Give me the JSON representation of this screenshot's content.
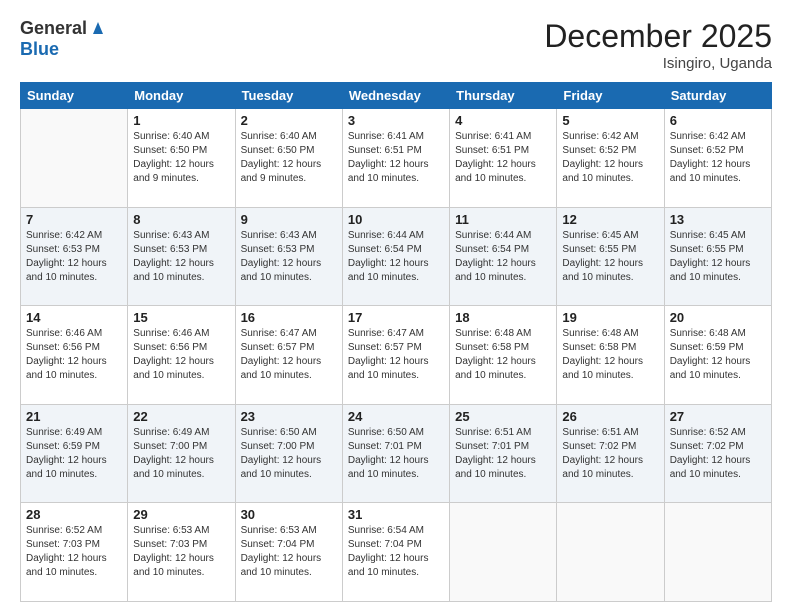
{
  "logo": {
    "general": "General",
    "blue": "Blue"
  },
  "header": {
    "title": "December 2025",
    "subtitle": "Isingiro, Uganda"
  },
  "days": [
    "Sunday",
    "Monday",
    "Tuesday",
    "Wednesday",
    "Thursday",
    "Friday",
    "Saturday"
  ],
  "weeks": [
    [
      {
        "day": "",
        "info": ""
      },
      {
        "day": "1",
        "info": "Sunrise: 6:40 AM\nSunset: 6:50 PM\nDaylight: 12 hours\nand 9 minutes."
      },
      {
        "day": "2",
        "info": "Sunrise: 6:40 AM\nSunset: 6:50 PM\nDaylight: 12 hours\nand 9 minutes."
      },
      {
        "day": "3",
        "info": "Sunrise: 6:41 AM\nSunset: 6:51 PM\nDaylight: 12 hours\nand 10 minutes."
      },
      {
        "day": "4",
        "info": "Sunrise: 6:41 AM\nSunset: 6:51 PM\nDaylight: 12 hours\nand 10 minutes."
      },
      {
        "day": "5",
        "info": "Sunrise: 6:42 AM\nSunset: 6:52 PM\nDaylight: 12 hours\nand 10 minutes."
      },
      {
        "day": "6",
        "info": "Sunrise: 6:42 AM\nSunset: 6:52 PM\nDaylight: 12 hours\nand 10 minutes."
      }
    ],
    [
      {
        "day": "7",
        "info": "Sunrise: 6:42 AM\nSunset: 6:53 PM\nDaylight: 12 hours\nand 10 minutes."
      },
      {
        "day": "8",
        "info": "Sunrise: 6:43 AM\nSunset: 6:53 PM\nDaylight: 12 hours\nand 10 minutes."
      },
      {
        "day": "9",
        "info": "Sunrise: 6:43 AM\nSunset: 6:53 PM\nDaylight: 12 hours\nand 10 minutes."
      },
      {
        "day": "10",
        "info": "Sunrise: 6:44 AM\nSunset: 6:54 PM\nDaylight: 12 hours\nand 10 minutes."
      },
      {
        "day": "11",
        "info": "Sunrise: 6:44 AM\nSunset: 6:54 PM\nDaylight: 12 hours\nand 10 minutes."
      },
      {
        "day": "12",
        "info": "Sunrise: 6:45 AM\nSunset: 6:55 PM\nDaylight: 12 hours\nand 10 minutes."
      },
      {
        "day": "13",
        "info": "Sunrise: 6:45 AM\nSunset: 6:55 PM\nDaylight: 12 hours\nand 10 minutes."
      }
    ],
    [
      {
        "day": "14",
        "info": "Sunrise: 6:46 AM\nSunset: 6:56 PM\nDaylight: 12 hours\nand 10 minutes."
      },
      {
        "day": "15",
        "info": "Sunrise: 6:46 AM\nSunset: 6:56 PM\nDaylight: 12 hours\nand 10 minutes."
      },
      {
        "day": "16",
        "info": "Sunrise: 6:47 AM\nSunset: 6:57 PM\nDaylight: 12 hours\nand 10 minutes."
      },
      {
        "day": "17",
        "info": "Sunrise: 6:47 AM\nSunset: 6:57 PM\nDaylight: 12 hours\nand 10 minutes."
      },
      {
        "day": "18",
        "info": "Sunrise: 6:48 AM\nSunset: 6:58 PM\nDaylight: 12 hours\nand 10 minutes."
      },
      {
        "day": "19",
        "info": "Sunrise: 6:48 AM\nSunset: 6:58 PM\nDaylight: 12 hours\nand 10 minutes."
      },
      {
        "day": "20",
        "info": "Sunrise: 6:48 AM\nSunset: 6:59 PM\nDaylight: 12 hours\nand 10 minutes."
      }
    ],
    [
      {
        "day": "21",
        "info": "Sunrise: 6:49 AM\nSunset: 6:59 PM\nDaylight: 12 hours\nand 10 minutes."
      },
      {
        "day": "22",
        "info": "Sunrise: 6:49 AM\nSunset: 7:00 PM\nDaylight: 12 hours\nand 10 minutes."
      },
      {
        "day": "23",
        "info": "Sunrise: 6:50 AM\nSunset: 7:00 PM\nDaylight: 12 hours\nand 10 minutes."
      },
      {
        "day": "24",
        "info": "Sunrise: 6:50 AM\nSunset: 7:01 PM\nDaylight: 12 hours\nand 10 minutes."
      },
      {
        "day": "25",
        "info": "Sunrise: 6:51 AM\nSunset: 7:01 PM\nDaylight: 12 hours\nand 10 minutes."
      },
      {
        "day": "26",
        "info": "Sunrise: 6:51 AM\nSunset: 7:02 PM\nDaylight: 12 hours\nand 10 minutes."
      },
      {
        "day": "27",
        "info": "Sunrise: 6:52 AM\nSunset: 7:02 PM\nDaylight: 12 hours\nand 10 minutes."
      }
    ],
    [
      {
        "day": "28",
        "info": "Sunrise: 6:52 AM\nSunset: 7:03 PM\nDaylight: 12 hours\nand 10 minutes."
      },
      {
        "day": "29",
        "info": "Sunrise: 6:53 AM\nSunset: 7:03 PM\nDaylight: 12 hours\nand 10 minutes."
      },
      {
        "day": "30",
        "info": "Sunrise: 6:53 AM\nSunset: 7:04 PM\nDaylight: 12 hours\nand 10 minutes."
      },
      {
        "day": "31",
        "info": "Sunrise: 6:54 AM\nSunset: 7:04 PM\nDaylight: 12 hours\nand 10 minutes."
      },
      {
        "day": "",
        "info": ""
      },
      {
        "day": "",
        "info": ""
      },
      {
        "day": "",
        "info": ""
      }
    ]
  ]
}
